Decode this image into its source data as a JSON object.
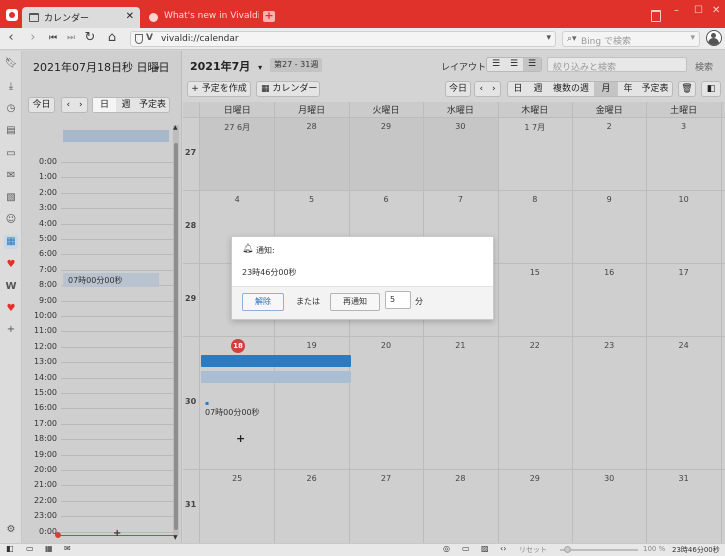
{
  "tabs": [
    {
      "title": "カレンダー"
    },
    {
      "title": "What's new in Vivaldi | Viv"
    }
  ],
  "address": {
    "url": "vivaldi://calendar",
    "search_placeholder": "Bing で検索"
  },
  "left": {
    "date_header": "2021年07月18日秒 日曜日",
    "today_label": "今日",
    "view_day": "日",
    "view_week": "週",
    "view_agenda": "予定表",
    "hours": [
      "0:00",
      "1:00",
      "2:00",
      "3:00",
      "4:00",
      "5:00",
      "6:00",
      "7:00",
      "8:00",
      "9:00",
      "10:00",
      "11:00",
      "12:00",
      "13:00",
      "14:00",
      "15:00",
      "16:00",
      "17:00",
      "18:00",
      "19:00",
      "20:00",
      "21:00",
      "22:00",
      "23:00",
      "0:00"
    ],
    "event_label": "07時00分00秒",
    "add_label": "+"
  },
  "main": {
    "month_title": "2021年7月",
    "week_range": "第27 - 31週",
    "layout_label": "レイアウト",
    "filter_placeholder": "絞り込みと検索",
    "search_label": "検索",
    "create_label": "+ 予定を作成",
    "calendar_label": "カレンダー",
    "today_label": "今日",
    "views": [
      "日",
      "週",
      "複数の週",
      "月",
      "年",
      "予定表"
    ],
    "days": [
      "日曜日",
      "月曜日",
      "火曜日",
      "水曜日",
      "木曜日",
      "金曜日",
      "土曜日"
    ],
    "weeks": [
      {
        "num": "27",
        "dates": [
          "27 6月",
          "28",
          "29",
          "30",
          "1 7月",
          "2",
          "3"
        ]
      },
      {
        "num": "28",
        "dates": [
          "4",
          "5",
          "6",
          "7",
          "8",
          "9",
          "10"
        ]
      },
      {
        "num": "29",
        "dates": [
          "",
          "",
          "",
          "",
          "15",
          "16",
          "17"
        ]
      },
      {
        "num": "30",
        "dates": [
          "18",
          "19",
          "20",
          "21",
          "22",
          "23",
          "24"
        ]
      },
      {
        "num": "31",
        "dates": [
          "25",
          "26",
          "27",
          "28",
          "29",
          "30",
          "31"
        ]
      }
    ],
    "event_time": "07時00分00秒",
    "add_label": "+"
  },
  "dialog": {
    "title": "通知:",
    "time": "23時46分00秒",
    "dismiss": "解除",
    "or": "または",
    "snooze": "再通知",
    "minutes_value": "5",
    "minutes_unit": "分"
  },
  "status": {
    "reset": "リセット",
    "zoom": "100 %",
    "clock": "23時46分00秒"
  },
  "colors": {
    "accent": "#e0322a",
    "event": "#2a7bc2",
    "today": "#d1403a"
  }
}
